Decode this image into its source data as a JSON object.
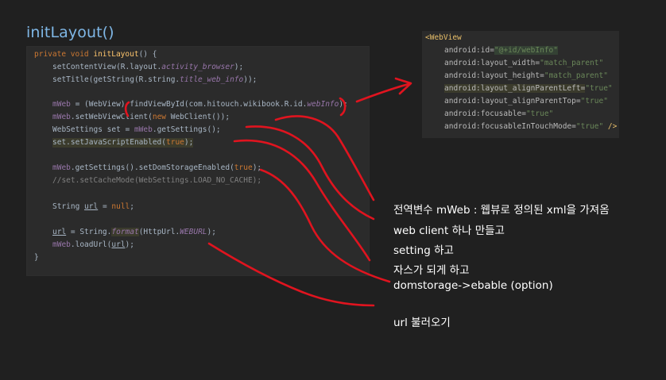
{
  "slide": {
    "title": "initLayout()"
  },
  "java_code": {
    "l1": {
      "kw": "private void ",
      "fn": "initLayout",
      "rest": "() {"
    },
    "l2": {
      "a": "setContentView(R.layout.",
      "it": "activity_browser",
      "b": ");"
    },
    "l3": {
      "a": "setTitle(getString(R.string.",
      "it": "title_web_info",
      "b": "));"
    },
    "l4": {
      "fld": "mWeb",
      "a": " = (WebView) findViewById(com.hitouch.wikibook.R.id.",
      "it": "webInfo",
      "b": ");"
    },
    "l5": {
      "fld": "mWeb",
      "a": ".setWebViewClient(",
      "kw": "new ",
      "b": "WebClient());"
    },
    "l6": {
      "a": "WebSettings set = ",
      "fld": "mWeb",
      "b": ".getSettings();"
    },
    "l7": {
      "a": "set.setJavaScriptEnabled(",
      "kw": "true",
      "b": ");"
    },
    "l8": {
      "fld": "mWeb",
      "a": ".getSettings().setDomStorageEnabled(",
      "kw": "true",
      "b": ");"
    },
    "l9": {
      "cm": "//set.setCacheMode(WebSettings.LOAD_NO_CACHE);"
    },
    "l10": {
      "a": "String ",
      "u": "url",
      "b": " = ",
      "kw": "null",
      "c": ";"
    },
    "l11": {
      "u": "url",
      "a": " = String.",
      "it": "format",
      "b": "(HttpUrl.",
      "it2": "WEBURL",
      "c": ");"
    },
    "l12": {
      "fld": "mWeb",
      "a": ".loadUrl(",
      "u": "url",
      "b": ");"
    },
    "l13": {
      "a": "}"
    }
  },
  "xml_code": {
    "x1": "<WebView",
    "x2": {
      "at": "android:id=",
      "str": "\"@+id/webInfo\""
    },
    "x3": {
      "at": "android:layout_width=",
      "str": "\"match_parent\""
    },
    "x4": {
      "at": "android:layout_height=",
      "str": "\"match_parent\""
    },
    "x5": {
      "at": "android:layout_alignParentLeft=",
      "str": "\"true\""
    },
    "x6": {
      "at": "android:layout_alignParentTop=",
      "str": "\"true\""
    },
    "x7": {
      "at": "android:focusable=",
      "str": "\"true\""
    },
    "x8": {
      "at": "android:focusableInTouchMode=",
      "str": "\"true\"",
      "end": " />"
    }
  },
  "annotations": [
    "전역변수 mWeb : 웹뷰로 정의된 xml을 가져옴",
    "web client 하나 만들고",
    "setting 하고",
    "자스가 되게 하고",
    "domstorage->ebable (option)",
    "url 불러오기"
  ],
  "colors": {
    "ink": "#e0141f",
    "title": "#7fb7e6",
    "bg": "#202020",
    "panel": "#2b2b2b"
  }
}
